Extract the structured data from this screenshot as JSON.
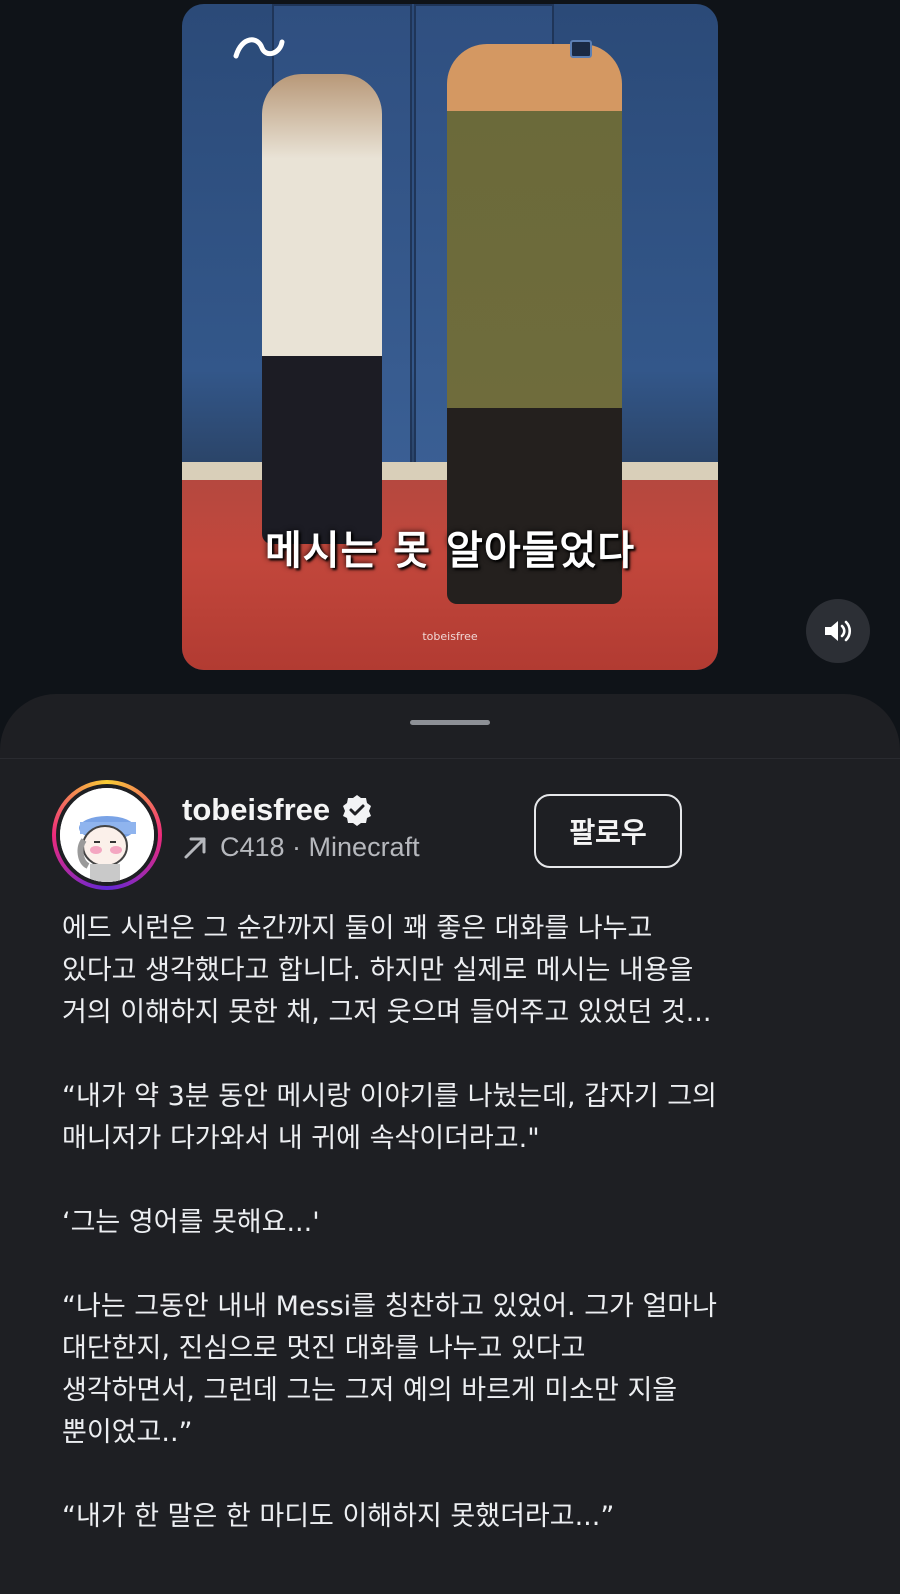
{
  "media": {
    "overlay_caption": "메시는 못 알아들었다",
    "watermark": "tobeisfree"
  },
  "author": {
    "username": "tobeisfree",
    "verified": true,
    "audio": "C418 · Minecraft"
  },
  "actions": {
    "follow_label": "팔로우"
  },
  "post": {
    "paragraphs": [
      [
        "에드 시런은 그 순간까지 둘이 꽤 좋은 대화를 나누고",
        "있다고 생각했다고 합니다. 하지만 실제로 메시는 내용을",
        "거의 이해하지 못한 채, 그저 웃으며 들어주고 있었던 것..."
      ],
      [
        "“내가 약 3분 동안 메시랑 이야기를 나눴는데, 갑자기 그의",
        "매니저가 다가와서 내 귀에 속삭이더라고.\""
      ],
      [
        "‘그는 영어를 못해요...'"
      ],
      [
        "“나는 그동안 내내 Messi를 칭찬하고 있었어. 그가 얼마나",
        "대단한지, 진심으로 멋진 대화를 나누고 있다고",
        "생각하면서, 그런데 그는 그저 예의 바르게 미소만 지을",
        "뿐이었고..”"
      ],
      [
        "“내가 한 말은 한 마디도 이해하지 못했더라고...”"
      ]
    ]
  },
  "icons": {
    "volume": "volume-icon",
    "verified": "verified-badge-icon",
    "audio_arrow": "arrow-up-right-icon"
  }
}
